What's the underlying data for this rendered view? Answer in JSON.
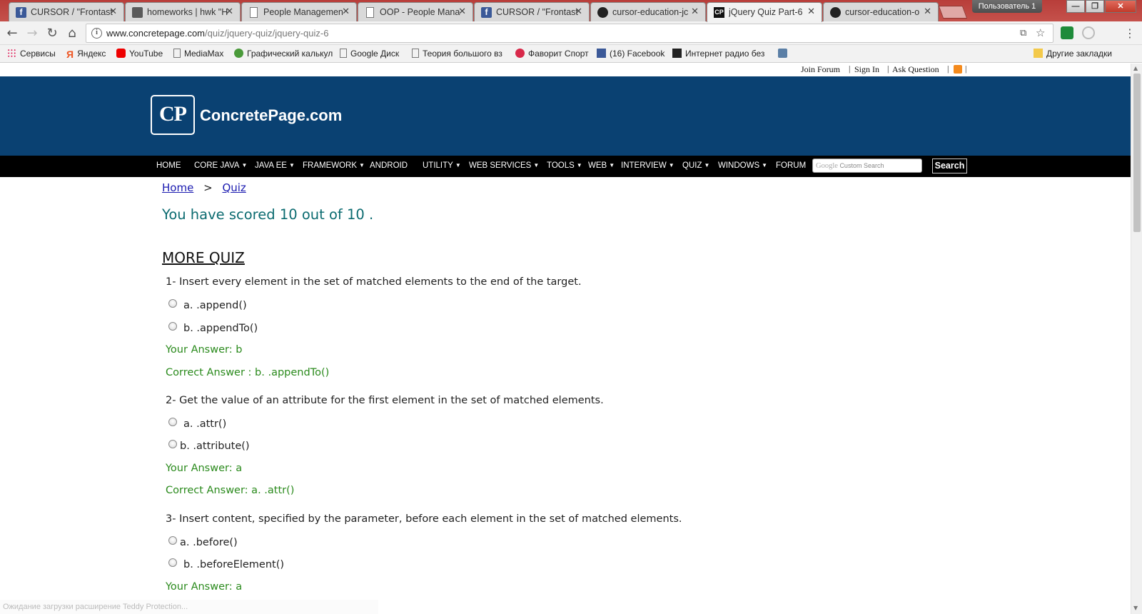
{
  "tabs": [
    {
      "title": "CURSOR / \"Frontast",
      "icon": "facebook-icon"
    },
    {
      "title": "homeworks | hwk \"H",
      "icon": "trello-icon"
    },
    {
      "title": "People Managemen",
      "icon": "document-icon"
    },
    {
      "title": "OOP - People Mana",
      "icon": "document-icon"
    },
    {
      "title": "CURSOR / \"Frontast",
      "icon": "facebook-icon"
    },
    {
      "title": "cursor-education-jc",
      "icon": "github-icon"
    },
    {
      "title": "jQuery Quiz Part-6",
      "icon": "concretepage-icon",
      "active": true
    },
    {
      "title": "cursor-education-o",
      "icon": "github-icon"
    }
  ],
  "window": {
    "user": "Пользователь 1"
  },
  "address_bar": {
    "host": "www.concretepage.com",
    "path": "/quiz/jquery-quiz/jquery-quiz-6"
  },
  "bookmarks": [
    {
      "label": "Сервисы",
      "icon": "apps-icon"
    },
    {
      "label": "Яндекс",
      "icon": "yandex-icon"
    },
    {
      "label": "YouTube",
      "icon": "youtube-icon"
    },
    {
      "label": "MediaMax",
      "icon": "document-icon"
    },
    {
      "label": "Графический калькул",
      "icon": "calculator-icon"
    },
    {
      "label": "Google Диск",
      "icon": "document-icon"
    },
    {
      "label": "Теория большого вз",
      "icon": "document-icon"
    },
    {
      "label": "Фаворит Спорт",
      "icon": "favorit-icon"
    },
    {
      "label": "(16) Facebook",
      "icon": "facebook-icon"
    },
    {
      "label": "Интернет радио без",
      "icon": "radio-icon"
    },
    {
      "label": "",
      "icon": "vk-icon"
    },
    {
      "label": "Другие закладки",
      "icon": "folder-icon"
    }
  ],
  "site": {
    "top_links": [
      "Join Forum",
      "Sign In",
      "Ask Question"
    ],
    "logo_mark": "CP",
    "logo_text": "ConcretePage.com",
    "nav": [
      {
        "label": "HOME",
        "dropdown": false
      },
      {
        "label": "CORE JAVA",
        "dropdown": true
      },
      {
        "label": "JAVA EE",
        "dropdown": true
      },
      {
        "label": "FRAMEWORK",
        "dropdown": true
      },
      {
        "label": "ANDROID",
        "dropdown": false
      },
      {
        "label": "UTILITY",
        "dropdown": true
      },
      {
        "label": "WEB SERVICES",
        "dropdown": true
      },
      {
        "label": "TOOLS",
        "dropdown": true
      },
      {
        "label": "WEB",
        "dropdown": true
      },
      {
        "label": "INTERVIEW",
        "dropdown": true
      },
      {
        "label": "QUIZ",
        "dropdown": true
      },
      {
        "label": "WINDOWS",
        "dropdown": true
      },
      {
        "label": "FORUM",
        "dropdown": false
      }
    ],
    "search": {
      "brand": "Google",
      "placeholder": "Custom Search",
      "button": "Search"
    },
    "colors": {
      "header_bg": "#0a4172",
      "nav_bg": "#000000",
      "score_color": "#0b6b70",
      "answer_color": "#2a8a1c",
      "link_color": "#1a1ab0"
    }
  },
  "breadcrumb": {
    "home": "Home",
    "separator": ">",
    "current": "Quiz"
  },
  "score_text": "You have scored 10 out of 10 .",
  "section_title": "MORE QUIZ",
  "questions": [
    {
      "text": "1- Insert every element in the set of matched elements to the end of the target.",
      "options": [
        "a. .append()",
        "b. .appendTo()"
      ],
      "your_answer": "Your Answer: b",
      "correct_answer": "Correct Answer : b. .appendTo()"
    },
    {
      "text": "2- Get the value of an attribute for the first element in the set of matched elements.",
      "options": [
        "a. .attr()",
        "b. .attribute()"
      ],
      "your_answer": "Your Answer: a",
      "correct_answer": "Correct Answer: a. .attr()"
    },
    {
      "text": "3- Insert content, specified by the parameter, before each element in the set of matched elements.",
      "options": [
        "a. .before()",
        "b. .beforeElement()"
      ],
      "your_answer": "Your Answer: a"
    }
  ],
  "status_bar": "Ожидание загрузки расширение Teddy Protection..."
}
